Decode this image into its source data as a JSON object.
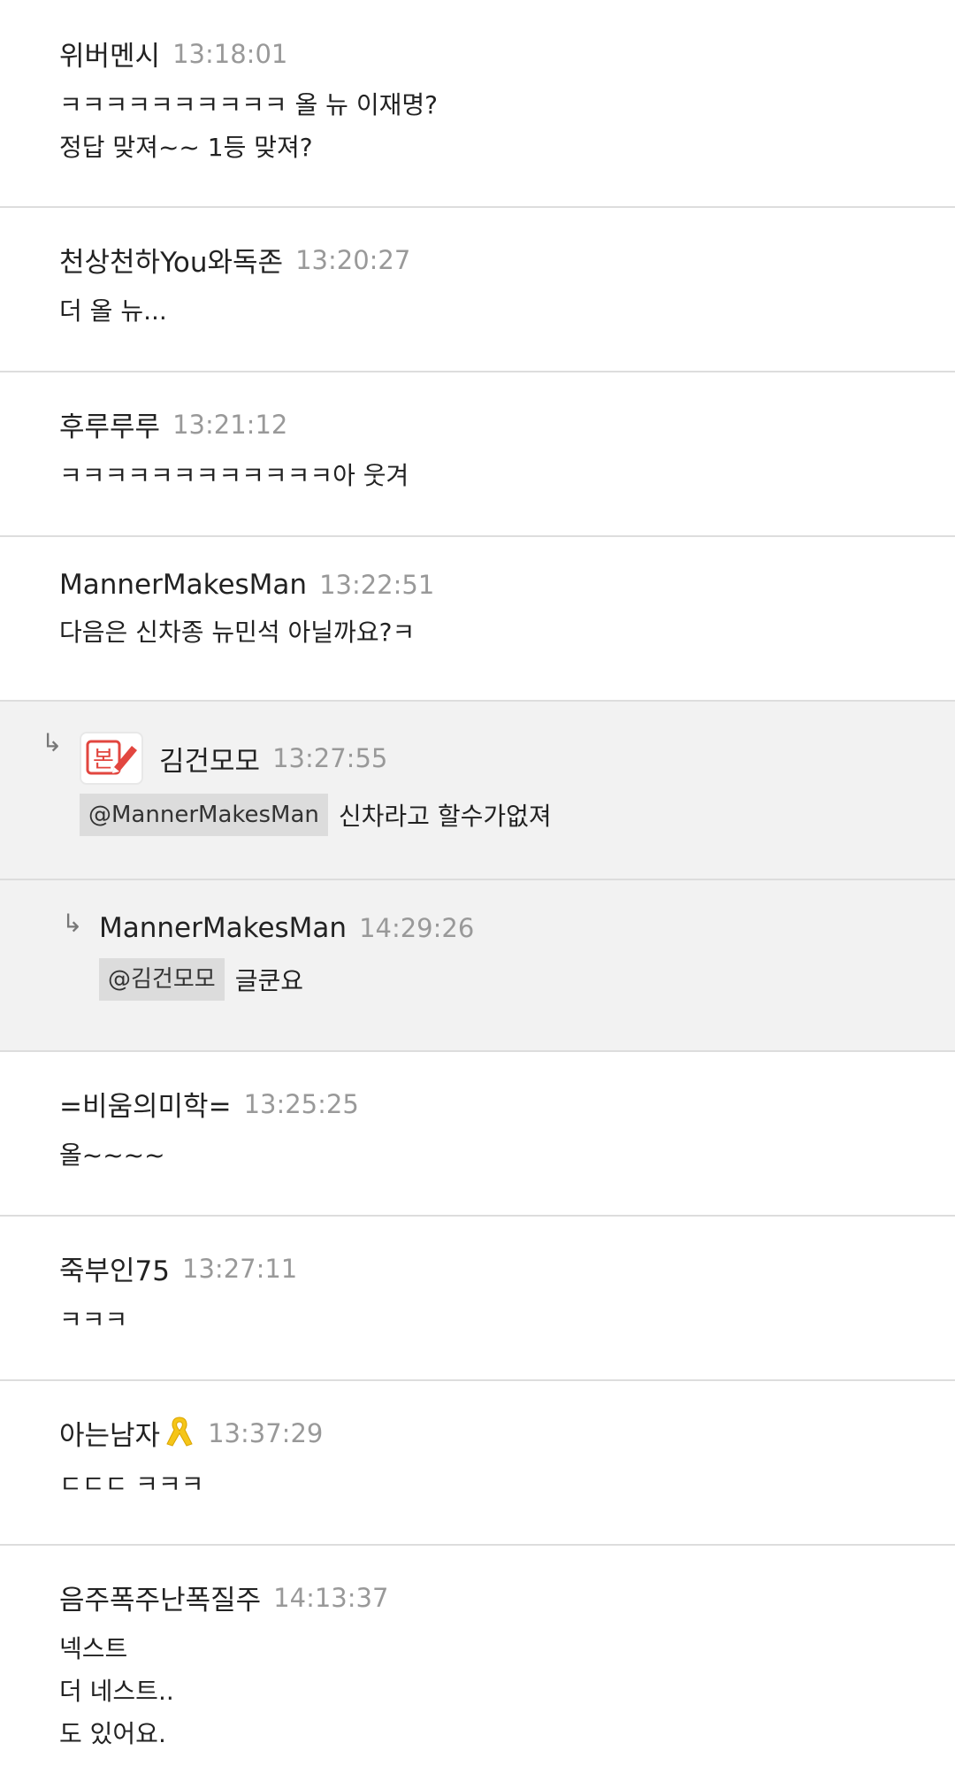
{
  "comments": [
    {
      "nickname": "위버멘시",
      "time": "13:18:01",
      "lines": [
        "ㅋㅋㅋㅋㅋㅋㅋㅋㅋㅋ 올 뉴 이재명?",
        "정답 맞져~~ 1등 맞져?"
      ]
    },
    {
      "nickname": "천상천하You와독존",
      "time": "13:20:27",
      "lines": [
        "더 올 뉴..."
      ]
    },
    {
      "nickname": "후루루루",
      "time": "13:21:12",
      "lines": [
        "ㅋㅋㅋㅋㅋㅋㅋㅋㅋㅋㅋㅋ아 웃겨"
      ]
    },
    {
      "nickname": "MannerMakesMan",
      "time": "13:22:51",
      "lines": [
        "다음은 신차종 뉴민석 아닐까요?ㅋ"
      ]
    }
  ],
  "replies": [
    {
      "arrow": "↳",
      "badge_label": "본",
      "badge_icon": "pencil-icon",
      "nickname": "김건모모",
      "time": "13:27:55",
      "mention": "@MannerMakesMan",
      "text": "신차라고 할수가없져"
    },
    {
      "arrow": "↳",
      "nickname": "MannerMakesMan",
      "time": "14:29:26",
      "mention": "@김건모모",
      "text": "글쿤요"
    }
  ],
  "comments_after": [
    {
      "nickname": "=비움의미학=",
      "time": "13:25:25",
      "lines": [
        "올~~~~"
      ]
    },
    {
      "nickname": "죽부인75",
      "time": "13:27:11",
      "lines": [
        "ㅋㅋㅋ"
      ]
    },
    {
      "nickname": "아는남자",
      "nickname_icon": "yellow-ribbon-icon",
      "time": "13:37:29",
      "lines": [
        "ㄷㄷㄷ ㅋㅋㅋ"
      ]
    },
    {
      "nickname": "음주폭주난폭질주",
      "time": "14:13:37",
      "lines": [
        "넥스트",
        "더 네스트..",
        "도 있어요."
      ]
    }
  ],
  "colors": {
    "text": "#222222",
    "time": "#999999",
    "divider": "#dddddd",
    "reply_bg": "#f2f2f2",
    "mention_bg": "#dcdcdc",
    "badge_red": "#e2463f",
    "ribbon_yellow": "#f5c518"
  }
}
